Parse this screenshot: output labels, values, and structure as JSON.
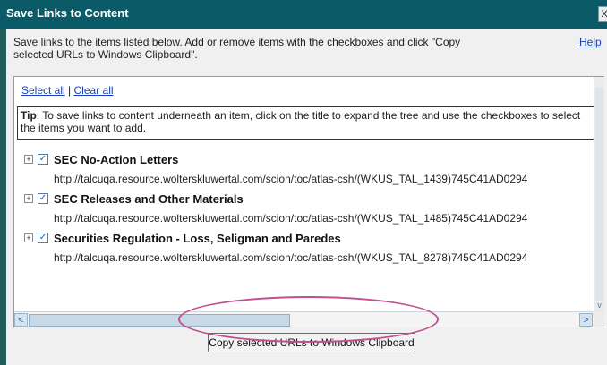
{
  "window": {
    "title": "Save Links to Content",
    "close_label": "X"
  },
  "dialog": {
    "intro": "Save links to the items listed below. Add or remove items with the checkboxes and click \"Copy selected URLs to Windows Clipboard\".",
    "help_label": "Help",
    "select_all_label": "Select all",
    "separator": "|",
    "clear_all_label": "Clear all",
    "tip_label": "Tip",
    "tip_text": ": To save links to content underneath an item, click on the title to expand the tree and use the checkboxes to select the items you want to add.",
    "copy_button_label": "Copy selected URLs to Windows Clipboard"
  },
  "items": [
    {
      "title": "SEC No-Action Letters",
      "url": "http://talcuqa.resource.wolterskluwertal.com/scion/toc/atlas-csh/(WKUS_TAL_1439)745C41AD0294",
      "checked": true
    },
    {
      "title": "SEC Releases and Other Materials",
      "url": "http://talcuqa.resource.wolterskluwertal.com/scion/toc/atlas-csh/(WKUS_TAL_1485)745C41AD0294",
      "checked": true
    },
    {
      "title": "Securities Regulation - Loss, Seligman and Paredes",
      "url": "http://talcuqa.resource.wolterskluwertal.com/scion/toc/atlas-csh/(WKUS_TAL_8278)745C41AD0294",
      "checked": true
    }
  ],
  "icons": {
    "expand": "+",
    "check": "✓",
    "scroll_left": "<",
    "scroll_right": ">",
    "scroll_down": "v"
  },
  "colors": {
    "titlebar": "#0a5a67",
    "link": "#1a3fb8",
    "annotation": "#c2508e"
  }
}
